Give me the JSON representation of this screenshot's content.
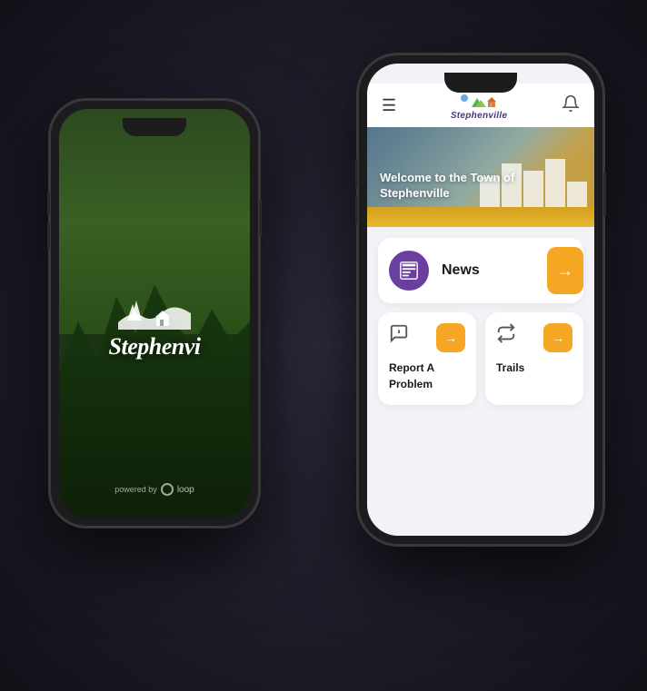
{
  "left_phone": {
    "logo_text": "Stephenvi",
    "powered_by_label": "powered by",
    "loop_label": "loop"
  },
  "right_phone": {
    "header": {
      "menu_icon": "☰",
      "logo_name": "Stephenville",
      "bell_icon": "🔔"
    },
    "hero": {
      "welcome_text": "Welcome to the Town of",
      "welcome_text2": "Stephenville"
    },
    "news": {
      "icon": "📰",
      "label": "News",
      "arrow": "→"
    },
    "report": {
      "icon": "💬",
      "label": "Report A Problem",
      "arrow": "→"
    },
    "trails": {
      "icon": "⇄",
      "label": "Trails",
      "arrow": "→"
    }
  },
  "colors": {
    "orange": "#f5a623",
    "purple": "#6b3fa0",
    "dark": "#1c1c1e"
  }
}
